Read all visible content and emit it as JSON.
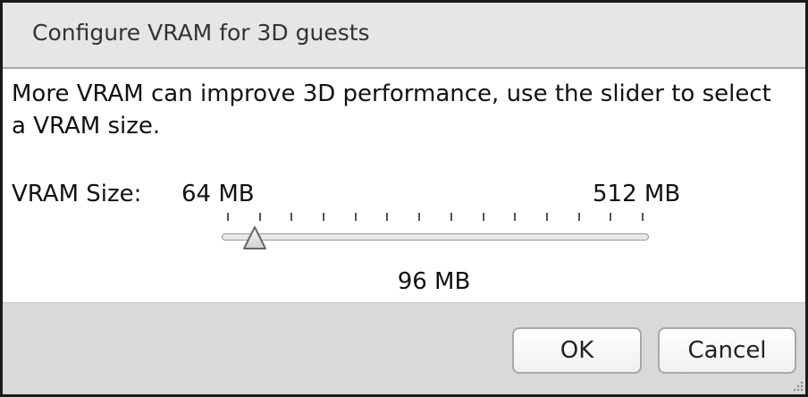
{
  "dialog": {
    "title": "Configure VRAM for 3D guests",
    "description": "More VRAM can improve 3D performance, use the slider to select a VRAM size."
  },
  "vram": {
    "label": "VRAM Size:",
    "min_label": "64 MB",
    "max_label": "512 MB",
    "min_mb": 64,
    "max_mb": 512,
    "value_mb": 96,
    "value_label": "96 MB",
    "tick_count": 14
  },
  "buttons": {
    "ok_label": "OK",
    "cancel_label": "Cancel"
  },
  "colors": {
    "titlebar": "#e6e6e6",
    "footer": "#d9d9d9",
    "border": "#1a1a1a"
  }
}
